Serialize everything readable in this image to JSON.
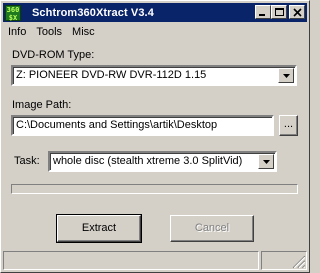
{
  "window": {
    "title": "Schtrom360Xtract V3.4",
    "icon": "app-logo-icon",
    "icon_text_top": "360",
    "icon_text_bottom": "$X"
  },
  "menu": {
    "items": [
      {
        "label": "Info"
      },
      {
        "label": "Tools"
      },
      {
        "label": "Misc"
      }
    ]
  },
  "dvd": {
    "label": "DVD-ROM Type:",
    "selected": "Z: PIONEER DVD-RW  DVR-112D 1.15"
  },
  "image_path": {
    "label": "Image Path:",
    "value": "C:\\Documents and Settings\\artik\\Desktop",
    "browse_label": "..."
  },
  "task": {
    "label": "Task:",
    "selected": "whole disc (stealth xtreme 3.0 SplitVid)"
  },
  "progress": {
    "value": 0
  },
  "buttons": {
    "extract": "Extract",
    "cancel": "Cancel"
  },
  "colors": {
    "titlebar": "#0a246a",
    "face": "#d4d0c8"
  }
}
